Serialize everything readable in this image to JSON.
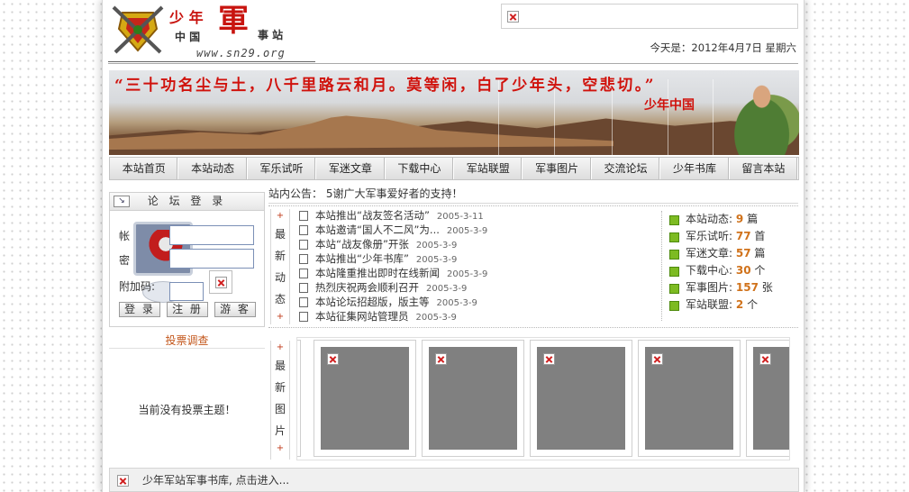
{
  "header": {
    "logo_text": "少年中国军事站",
    "logo_url": "www.sn29.org",
    "date_text": "今天是：2012年4月7日 星期六"
  },
  "banner": {
    "slogan": "“三十功名尘与土，八千里路云和月。莫等闲，白了少年头，空悲切。”",
    "brand": "少年中国"
  },
  "nav": [
    "本站首页",
    "本站动态",
    "军乐试听",
    "军迷文章",
    "下载中心",
    "军站联盟",
    "军事图片",
    "交流论坛",
    "少年书库",
    "留言本站"
  ],
  "login": {
    "title": "论 坛 登 录",
    "user_label": "帐",
    "pass_label": "密",
    "code_label": "附加码:",
    "buttons": [
      "登 录",
      "注 册",
      "游 客"
    ]
  },
  "vote": {
    "title": "投票调查",
    "empty": "当前没有投票主题！"
  },
  "notice": {
    "label": "站内公告：",
    "text": "5谢广大军事爱好者的支持！"
  },
  "news_label": [
    "最",
    "新",
    "动",
    "态"
  ],
  "pics_label": [
    "最",
    "新",
    "图",
    "片"
  ],
  "news": [
    {
      "title": "本站推出“战友签名活动”",
      "date": "2005-3-11"
    },
    {
      "title": "本站邀请“国人不二风”为...",
      "date": "2005-3-9"
    },
    {
      "title": "本站“战友像册”开张",
      "date": "2005-3-9"
    },
    {
      "title": "本站推出“少年书库”",
      "date": "2005-3-9"
    },
    {
      "title": "本站隆重推出即时在线新闻",
      "date": "2005-3-9"
    },
    {
      "title": "热烈庆祝两会顺利召开",
      "date": "2005-3-9"
    },
    {
      "title": "本站论坛招超版，版主等",
      "date": "2005-3-9"
    },
    {
      "title": "本站征集网站管理员",
      "date": "2005-3-9"
    }
  ],
  "stats": [
    {
      "label": "本站动态:",
      "value": "9",
      "unit": "篇"
    },
    {
      "label": "军乐试听:",
      "value": "77",
      "unit": "首"
    },
    {
      "label": "军迷文章:",
      "value": "57",
      "unit": "篇"
    },
    {
      "label": "下载中心:",
      "value": "30",
      "unit": "个"
    },
    {
      "label": "军事图片:",
      "value": "157",
      "unit": "张"
    },
    {
      "label": "军站联盟:",
      "value": "2",
      "unit": "个"
    }
  ],
  "footer": {
    "text": "少年军站军事书库, 点击进入..."
  },
  "colors": {
    "accent_red": "#d0120c",
    "stat_number": "#d0721b"
  }
}
